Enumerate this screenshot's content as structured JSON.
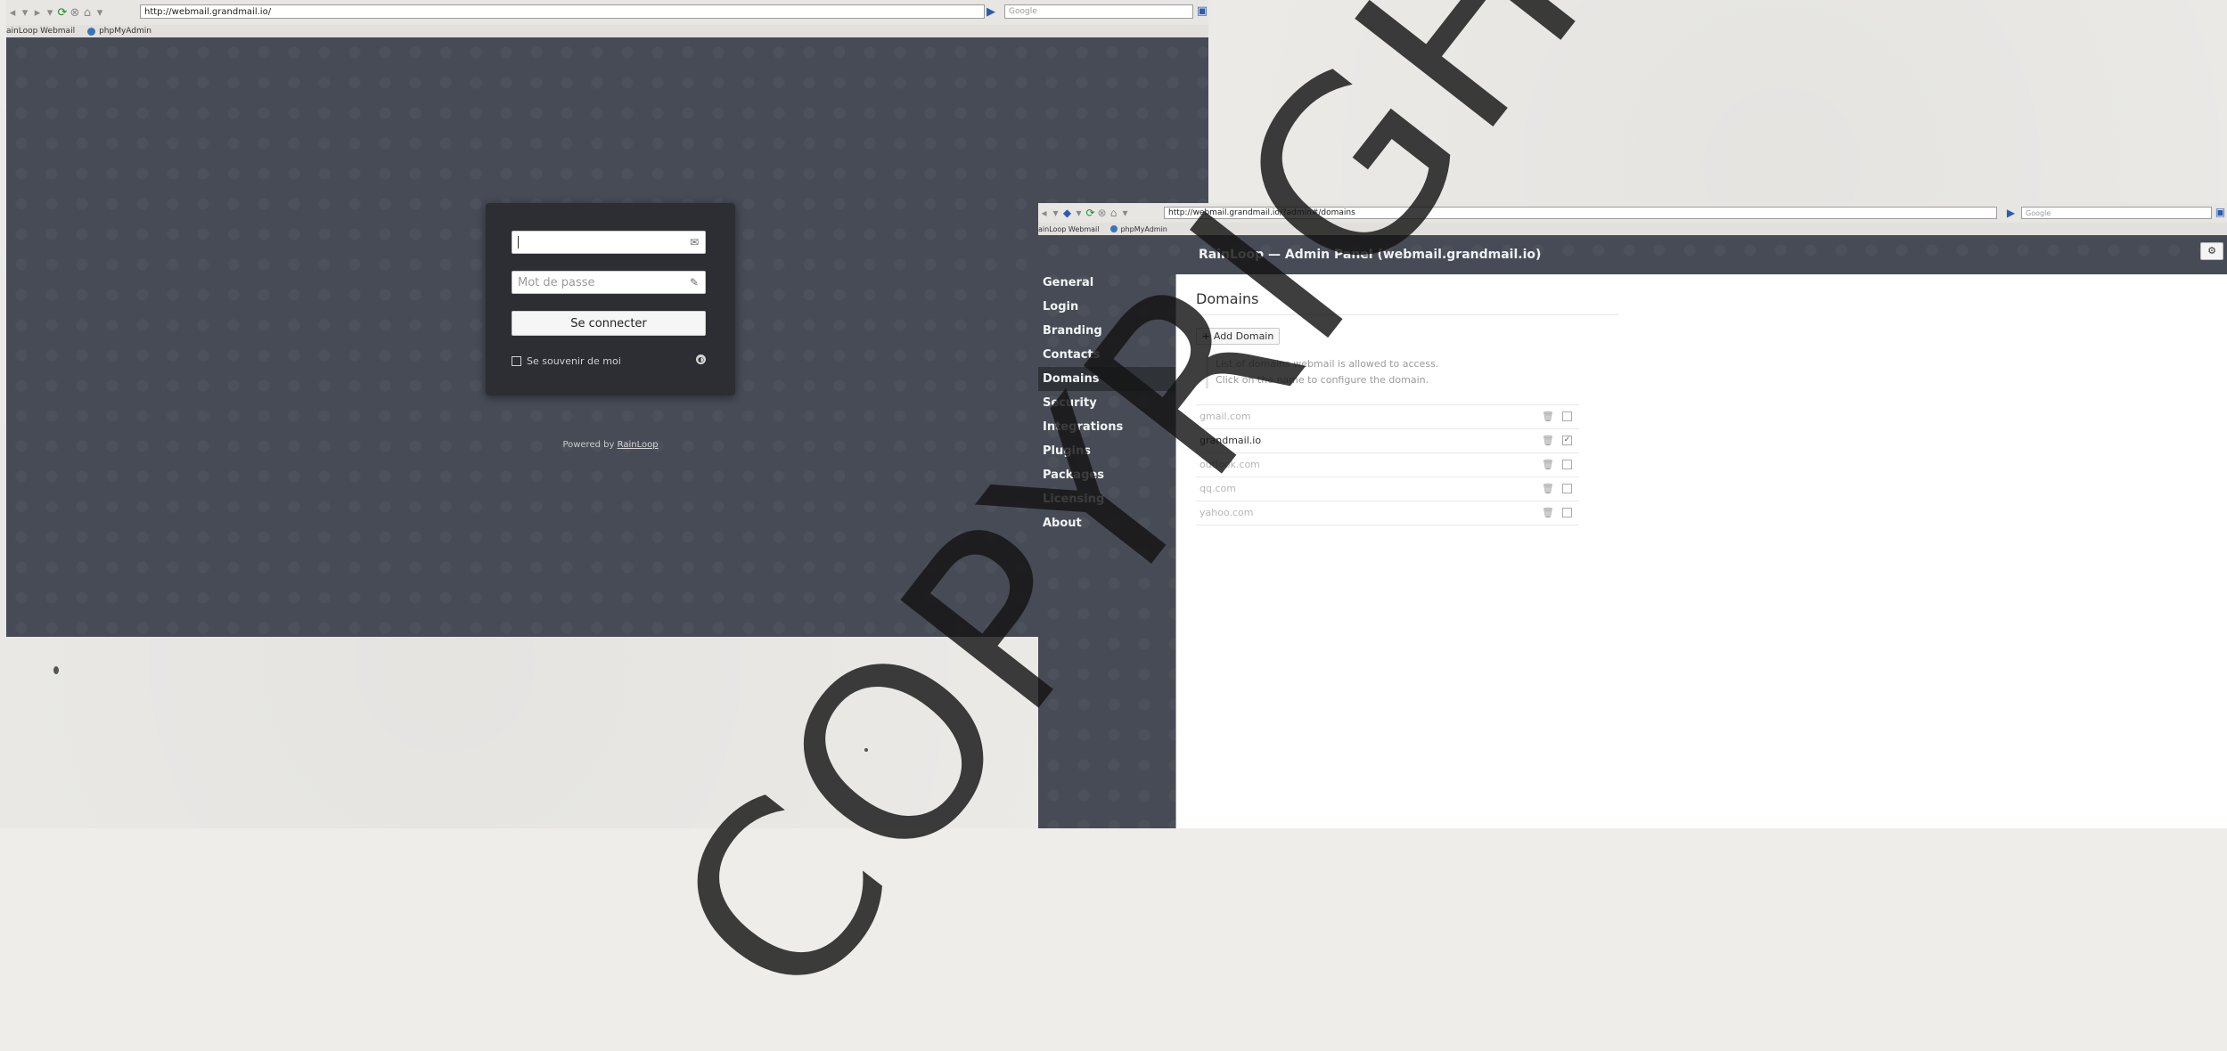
{
  "login_window": {
    "url": "http://webmail.grandmail.io/",
    "search_placeholder": "Google",
    "bookmarks": [
      "ainLoop Webmail",
      "phpMyAdmin"
    ],
    "form": {
      "username_value": "",
      "password_placeholder": "Mot de passe",
      "submit_label": "Se connecter",
      "remember_label": "Se souvenir de moi"
    },
    "powered_by_prefix": "Powered by",
    "powered_by_link": "RainLoop"
  },
  "admin_window": {
    "url": "http://webmail.grandmail.io/?admin#/domains",
    "search_placeholder": "Google",
    "bookmarks": [
      "ainLoop Webmail",
      "phpMyAdmin"
    ],
    "header_title": "RainLoop — Admin Panel  (webmail.grandmail.io)",
    "menu": [
      {
        "label": "General",
        "active": false
      },
      {
        "label": "Login",
        "active": false
      },
      {
        "label": "Branding",
        "active": false
      },
      {
        "label": "Contacts",
        "active": false
      },
      {
        "label": "Domains",
        "active": true
      },
      {
        "label": "Security",
        "active": false
      },
      {
        "label": "Integrations",
        "active": false
      },
      {
        "label": "Plugins",
        "active": false
      },
      {
        "label": "Packages",
        "active": false
      },
      {
        "label": "Licensing",
        "active": false
      },
      {
        "label": "About",
        "active": false
      }
    ],
    "section_title": "Domains",
    "add_domain_label": "Add Domain",
    "hint_line1": "List of domains webmail is allowed to access.",
    "hint_line2": "Click on the name to configure the domain.",
    "domains": [
      {
        "name": "gmail.com",
        "enabled": false
      },
      {
        "name": "grandmail.io",
        "enabled": true
      },
      {
        "name": "outlook.com",
        "enabled": false
      },
      {
        "name": "qq.com",
        "enabled": false
      },
      {
        "name": "yahoo.com",
        "enabled": false
      }
    ]
  },
  "watermark": "COPYRIGHT"
}
